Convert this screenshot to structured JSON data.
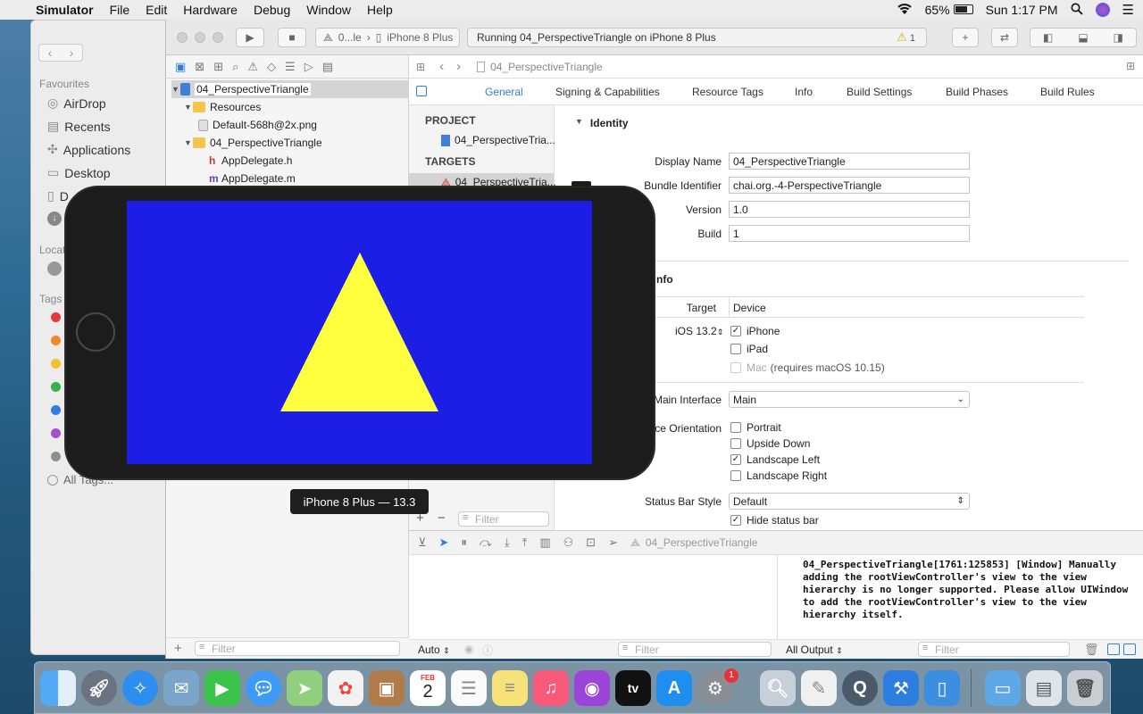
{
  "menubar": {
    "app_name": "Simulator",
    "items": [
      "File",
      "Edit",
      "Hardware",
      "Debug",
      "Window",
      "Help"
    ],
    "battery": "65%",
    "clock": "Sun 1:17 PM"
  },
  "finder": {
    "favourites_header": "Favourites",
    "favourites": [
      "AirDrop",
      "Recents",
      "Applications",
      "Desktop",
      "D"
    ],
    "locations_header": "Locat",
    "tags_header": "Tags",
    "all_tags": "All Tags..."
  },
  "xcode": {
    "scheme": "0...le",
    "device": "iPhone 8 Plus",
    "status": "Running 04_PerspectiveTriangle on iPhone 8 Plus",
    "warning_count": "1",
    "jumpbar_file": "04_PerspectiveTriangle",
    "navigator": {
      "project": "04_PerspectiveTriangle",
      "resources": "Resources",
      "default_png": "Default-568h@2x.png",
      "group": "04_PerspectiveTriangle",
      "appdelegate_h": "AppDelegate.h",
      "appdelegate_m": "AppDelegate.m",
      "filter_placeholder": "Filter"
    },
    "tabs": [
      "General",
      "Signing & Capabilities",
      "Resource Tags",
      "Info",
      "Build Settings",
      "Build Phases",
      "Build Rules"
    ],
    "project_header": "PROJECT",
    "project_item": "04_PerspectiveTria...",
    "targets_header": "TARGETS",
    "target_item": "04_PerspectiveTria...",
    "targets_filter": "Filter",
    "identity": {
      "header": "Identity",
      "display_name_label": "Display Name",
      "display_name": "04_PerspectiveTriangle",
      "bundle_label": "Bundle Identifier",
      "bundle": "chai.org.-4-PerspectiveTriangle",
      "version_label": "Version",
      "version": "1.0",
      "build_label": "Build",
      "build": "1"
    },
    "deployment": {
      "header": "nfo",
      "target_label": "Target",
      "device_label": "Device",
      "ios": "iOS 13.2",
      "iphone": "iPhone",
      "ipad": "iPad",
      "mac": "Mac",
      "mac_note": "(requires macOS 10.15)",
      "main_interface_label": "Main Interface",
      "main_interface": "Main",
      "orientation_label": "ce Orientation",
      "portrait": "Portrait",
      "upside_down": "Upside Down",
      "landscape_left": "Landscape Left",
      "landscape_right": "Landscape Right",
      "status_bar_label": "Status Bar Style",
      "status_bar": "Default",
      "hide_status": "Hide status bar"
    },
    "debug_target": "04_PerspectiveTriangle",
    "console_text": "04_PerspectiveTriangle[1761:125853] [Window] Manually adding the rootViewController's view to the view hierarchy is no longer supported. Please allow UIWindow to add the rootViewController's view to the view hierarchy itself.",
    "auto_label": "Auto",
    "all_output": "All Output",
    "filter": "Filter"
  },
  "simulator": {
    "caption": "iPhone 8 Plus — 13.3",
    "screen_color": "#1c1ee6",
    "triangle_color": "#ffff40"
  },
  "dock": {
    "calendar_month": "FEB",
    "calendar_day": "2",
    "appstore_badge": "1",
    "tv_label": "tv"
  }
}
